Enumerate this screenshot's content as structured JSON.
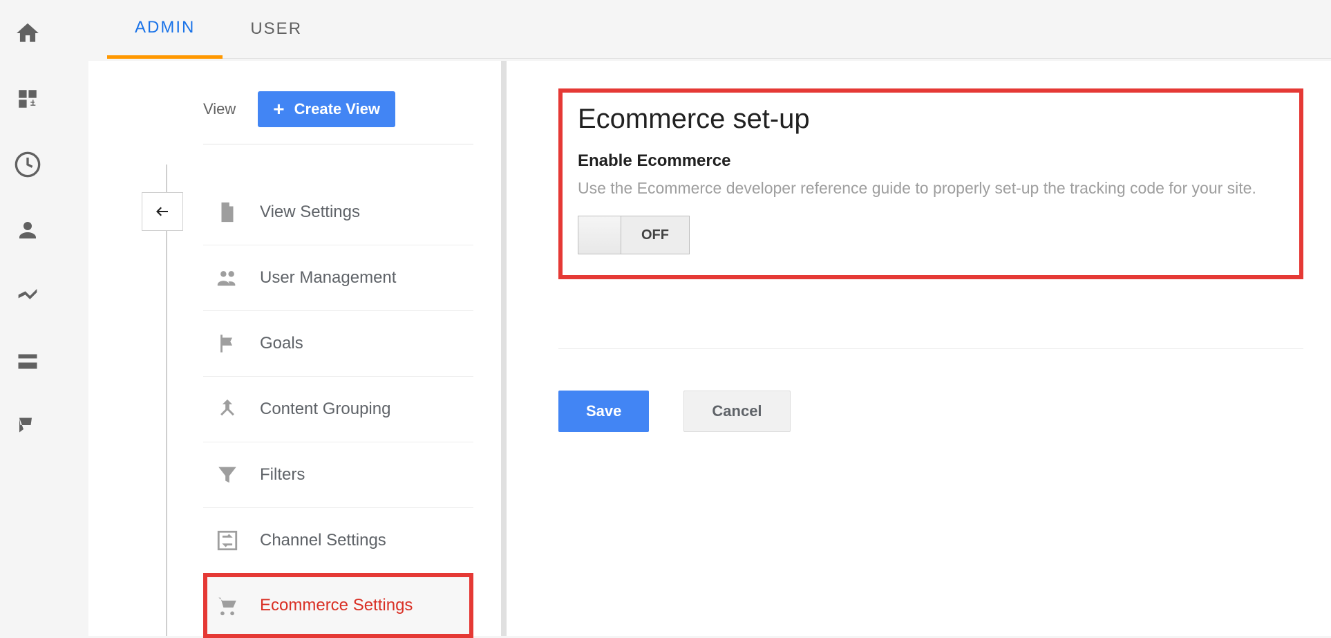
{
  "tabs": {
    "admin": "ADMIN",
    "user": "USER"
  },
  "view": {
    "label": "View",
    "create_button": "Create View"
  },
  "menu": {
    "view_settings": "View Settings",
    "user_management": "User Management",
    "goals": "Goals",
    "content_grouping": "Content Grouping",
    "filters": "Filters",
    "channel_settings": "Channel Settings",
    "ecommerce_settings": "Ecommerce Settings"
  },
  "ecommerce": {
    "title": "Ecommerce set-up",
    "subtitle": "Enable Ecommerce",
    "description": "Use the Ecommerce developer reference guide to properly set-up the tracking code for your site.",
    "toggle_state": "OFF"
  },
  "actions": {
    "save": "Save",
    "cancel": "Cancel"
  }
}
